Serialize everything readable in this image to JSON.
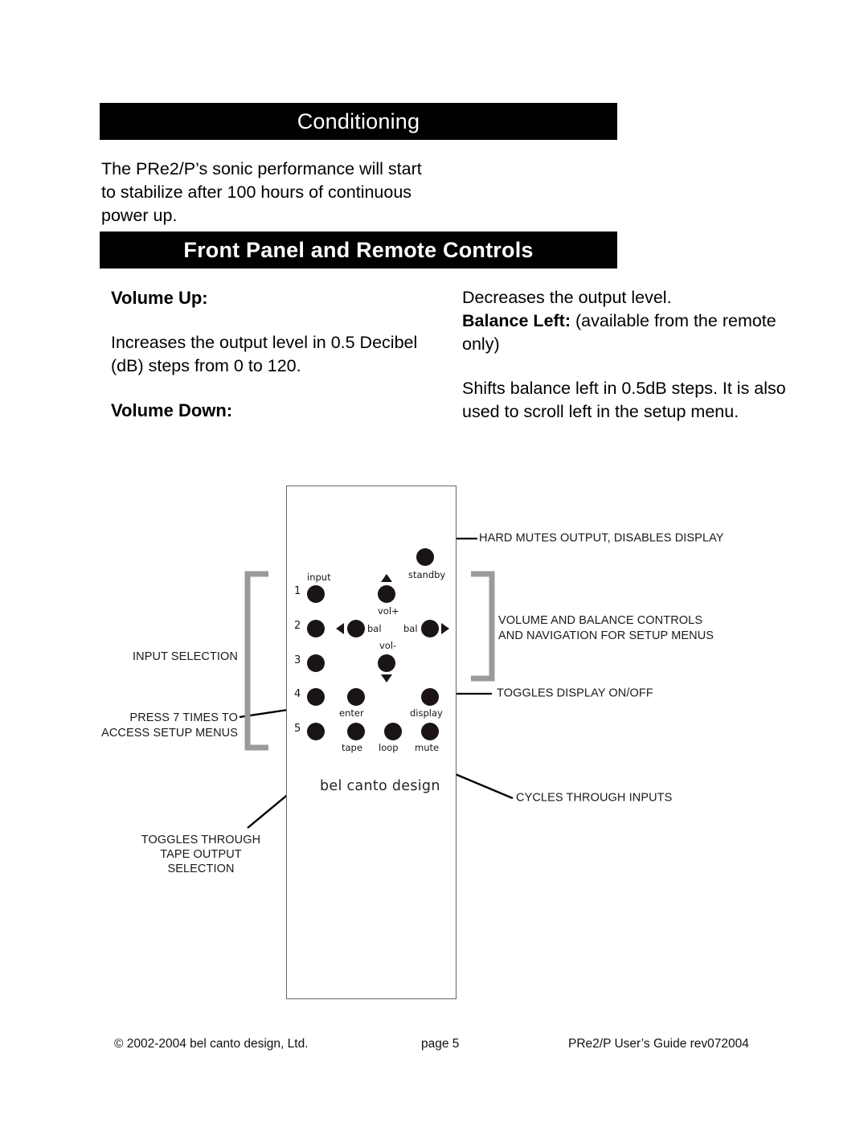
{
  "document": {
    "sections": [
      {
        "id": "conditioning",
        "title": "Conditioning"
      },
      {
        "id": "front_panel",
        "title": "Front Panel and Remote Controls"
      }
    ],
    "conditioning_body": "The PRe2/P’s sonic performance will start to stabilize after 100 hours of continuous power up.",
    "left_column": {
      "volume_up_heading": "Volume Up:",
      "volume_up_body": "Increases the output level in 0.5 Decibel (dB) steps from 0 to 120.",
      "volume_down_heading": "Volume Down:"
    },
    "right_column": {
      "decrease_line": "Decreases the output level.",
      "balance_left_heading": "Balance Left:",
      "balance_left_rest": " (available from the remote only)",
      "balance_left_body": "Shifts balance left in 0.5dB steps. It is also used to scroll left in the setup menu."
    }
  },
  "remote": {
    "brand": "bel canto design",
    "numbers": [
      "1",
      "2",
      "3",
      "4",
      "5"
    ],
    "buttons": {
      "input": "input",
      "standby": "standby",
      "vol_up": "vol+",
      "vol_down": "vol-",
      "bal_left": "bal",
      "bal_right": "bal",
      "enter": "enter",
      "display": "display",
      "tape": "tape",
      "loop": "loop",
      "mute": "mute"
    }
  },
  "callouts": {
    "hard_mute": "HARD MUTES OUTPUT, DISABLES DISPLAY",
    "volume_balance_line1": "VOLUME AND BALANCE CONTROLS",
    "volume_balance_line2": "AND NAVIGATION FOR SETUP MENUS",
    "toggles_display": "TOGGLES DISPLAY ON/OFF",
    "cycles_inputs": "CYCLES THROUGH INPUTS",
    "input_selection": "INPUT SELECTION",
    "press_7_line1": "PRESS 7 TIMES TO",
    "press_7_line2": "ACCESS SETUP MENUS",
    "tape_output_line1": "TOGGLES THROUGH",
    "tape_output_line2": "TAPE OUTPUT",
    "tape_output_line3": "SELECTION"
  },
  "footer": {
    "copyright": "© 2002-2004 bel canto design, Ltd.",
    "page": "page 5",
    "guide": "PRe2/P User’s Guide rev072004"
  },
  "colors": {
    "bar_background": "#000000",
    "bar_text": "#ffffff",
    "button_fill": "#1a1418",
    "bracket_gray": "#9a9a9a",
    "remote_outline": "#6b5f70"
  }
}
